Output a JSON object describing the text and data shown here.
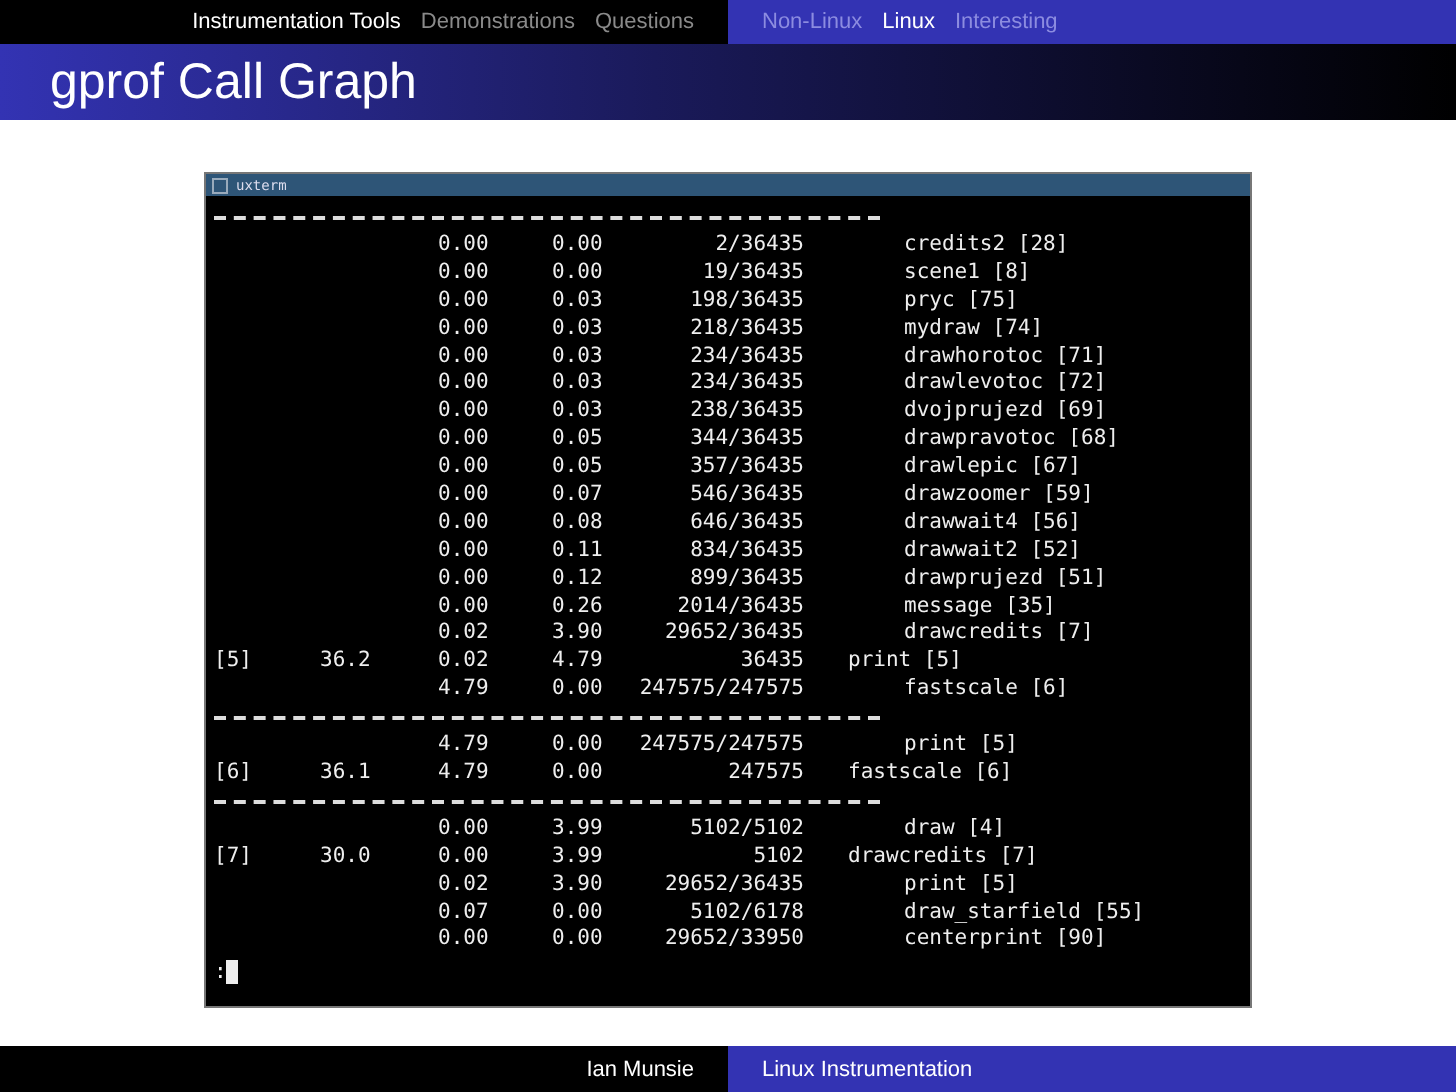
{
  "sections": [
    {
      "label": "Instrumentation Tools",
      "selected": true
    },
    {
      "label": "Demonstrations",
      "selected": false
    },
    {
      "label": "Questions",
      "selected": false
    }
  ],
  "subsections": [
    {
      "label": "Non-Linux",
      "selected": false
    },
    {
      "label": "Linux",
      "selected": true
    },
    {
      "label": "Interesting",
      "selected": false
    }
  ],
  "title": "gprof Call Graph",
  "terminal": {
    "title": "uxterm",
    "prompt": ":",
    "lines": [
      {
        "kind": "rule"
      },
      {
        "kind": "related",
        "self": "0.00",
        "children": "0.00",
        "called": "2/36435",
        "name": "credits2 [28]"
      },
      {
        "kind": "related",
        "self": "0.00",
        "children": "0.00",
        "called": "19/36435",
        "name": "scene1 [8]"
      },
      {
        "kind": "related",
        "self": "0.00",
        "children": "0.03",
        "called": "198/36435",
        "name": "pryc [75]"
      },
      {
        "kind": "related",
        "self": "0.00",
        "children": "0.03",
        "called": "218/36435",
        "name": "mydraw [74]"
      },
      {
        "kind": "related",
        "self": "0.00",
        "children": "0.03",
        "called": "234/36435",
        "name": "drawhorotoc [71]"
      },
      {
        "kind": "related",
        "self": "0.00",
        "children": "0.03",
        "called": "234/36435",
        "name": "drawlevotoc [72]"
      },
      {
        "kind": "related",
        "self": "0.00",
        "children": "0.03",
        "called": "238/36435",
        "name": "dvojprujezd [69]"
      },
      {
        "kind": "related",
        "self": "0.00",
        "children": "0.05",
        "called": "344/36435",
        "name": "drawpravotoc [68]"
      },
      {
        "kind": "related",
        "self": "0.00",
        "children": "0.05",
        "called": "357/36435",
        "name": "drawlepic [67]"
      },
      {
        "kind": "related",
        "self": "0.00",
        "children": "0.07",
        "called": "546/36435",
        "name": "drawzoomer [59]"
      },
      {
        "kind": "related",
        "self": "0.00",
        "children": "0.08",
        "called": "646/36435",
        "name": "drawwait4 [56]"
      },
      {
        "kind": "related",
        "self": "0.00",
        "children": "0.11",
        "called": "834/36435",
        "name": "drawwait2 [52]"
      },
      {
        "kind": "related",
        "self": "0.00",
        "children": "0.12",
        "called": "899/36435",
        "name": "drawprujezd [51]"
      },
      {
        "kind": "related",
        "self": "0.00",
        "children": "0.26",
        "called": "2014/36435",
        "name": "message [35]"
      },
      {
        "kind": "related",
        "self": "0.02",
        "children": "3.90",
        "called": "29652/36435",
        "name": "drawcredits [7]"
      },
      {
        "kind": "primary",
        "index": "[5]",
        "percent": "36.2",
        "self": "0.02",
        "children": "4.79",
        "called": "36435",
        "name": "print [5]"
      },
      {
        "kind": "related",
        "self": "4.79",
        "children": "0.00",
        "called": "247575/247575",
        "name": "fastscale [6]"
      },
      {
        "kind": "rule"
      },
      {
        "kind": "related",
        "self": "4.79",
        "children": "0.00",
        "called": "247575/247575",
        "name": "print [5]"
      },
      {
        "kind": "primary",
        "index": "[6]",
        "percent": "36.1",
        "self": "4.79",
        "children": "0.00",
        "called": "247575",
        "name": "fastscale [6]"
      },
      {
        "kind": "rule"
      },
      {
        "kind": "related",
        "self": "0.00",
        "children": "3.99",
        "called": "5102/5102",
        "name": "draw [4]"
      },
      {
        "kind": "primary",
        "index": "[7]",
        "percent": "30.0",
        "self": "0.00",
        "children": "3.99",
        "called": "5102",
        "name": "drawcredits [7]"
      },
      {
        "kind": "related",
        "self": "0.02",
        "children": "3.90",
        "called": "29652/36435",
        "name": "print [5]"
      },
      {
        "kind": "related",
        "self": "0.07",
        "children": "0.00",
        "called": "5102/6178",
        "name": "draw_starfield [55]"
      },
      {
        "kind": "related",
        "self": "0.00",
        "children": "0.00",
        "called": "29652/33950",
        "name": "centerprint [90]"
      }
    ]
  },
  "footer": {
    "author": "Ian Munsie",
    "short_title": "Linux Instrumentation"
  }
}
